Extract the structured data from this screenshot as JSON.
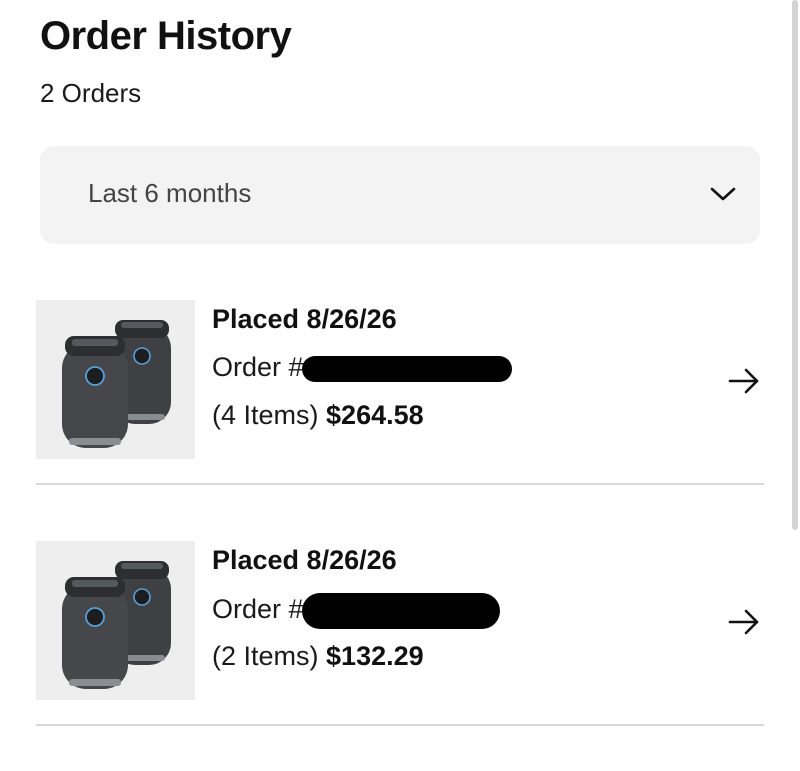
{
  "header": {
    "title": "Order History",
    "count": "2 Orders"
  },
  "filter": {
    "selected": "Last 6 months",
    "icon": "chevron-down-icon"
  },
  "orders": [
    {
      "placed": "Placed 8/26/26",
      "order_prefix": "Order #",
      "items": "(4 Items)",
      "total": "$264.58",
      "icon": "arrow-right-icon"
    },
    {
      "placed": "Placed 8/26/26",
      "order_prefix": "Order #",
      "items": "(2 Items)",
      "total": "$132.29",
      "icon": "arrow-right-icon"
    }
  ],
  "colors": {
    "text": "#111111",
    "filter_bg": "#f3f3f3",
    "divider": "#d8d8d8",
    "thumb_bg": "#eeeeee"
  }
}
